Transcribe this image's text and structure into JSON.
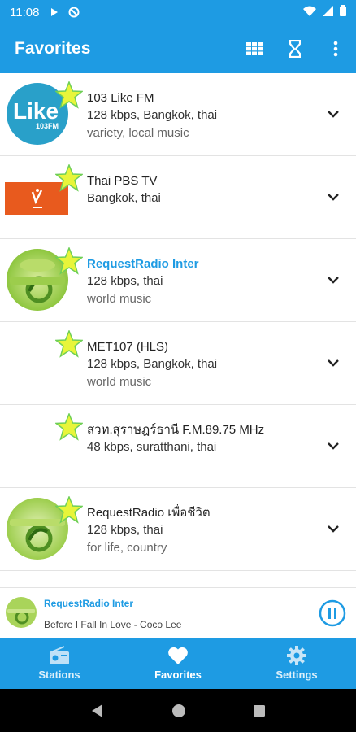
{
  "status_bar": {
    "time": "11:08"
  },
  "app_bar": {
    "title": "Favorites"
  },
  "stations": [
    {
      "name": "103 Like FM",
      "detail": "128 kbps, Bangkok, thai",
      "genre": "variety, local music",
      "logo": "like-fm-logo",
      "logo_text": "Like",
      "logo_subtext": "103FM",
      "active": false
    },
    {
      "name": "Thai PBS TV",
      "detail": "Bangkok, thai",
      "genre": "",
      "logo": "thai-pbs-logo",
      "active": false
    },
    {
      "name": "RequestRadio Inter",
      "detail": "128 kbps, thai",
      "genre": "world music",
      "logo": "requestradio-logo",
      "active": true
    },
    {
      "name": "MET107 (HLS)",
      "detail": "128 kbps, Bangkok, thai",
      "genre": "world music",
      "logo": "",
      "active": false
    },
    {
      "name": "สวท.สุราษฎร์ธานี F.M.89.75 MHz",
      "detail": "48 kbps, suratthani, thai",
      "genre": "",
      "logo": "",
      "active": false
    },
    {
      "name": "RequestRadio เพื่อชีวิต",
      "detail": "128 kbps, thai",
      "genre": "for life, country",
      "logo": "requestradio-logo",
      "active": false
    }
  ],
  "now_playing": {
    "station": "RequestRadio Inter",
    "song": "Before I Fall In Love - Coco Lee"
  },
  "bottom_nav": [
    {
      "label": "Stations",
      "icon": "radio-icon"
    },
    {
      "label": "Favorites",
      "icon": "heart-icon"
    },
    {
      "label": "Settings",
      "icon": "gear-icon"
    }
  ],
  "colors": {
    "primary": "#1e9be3",
    "star": "#e8f53a",
    "star_outline": "#6fcf57"
  }
}
